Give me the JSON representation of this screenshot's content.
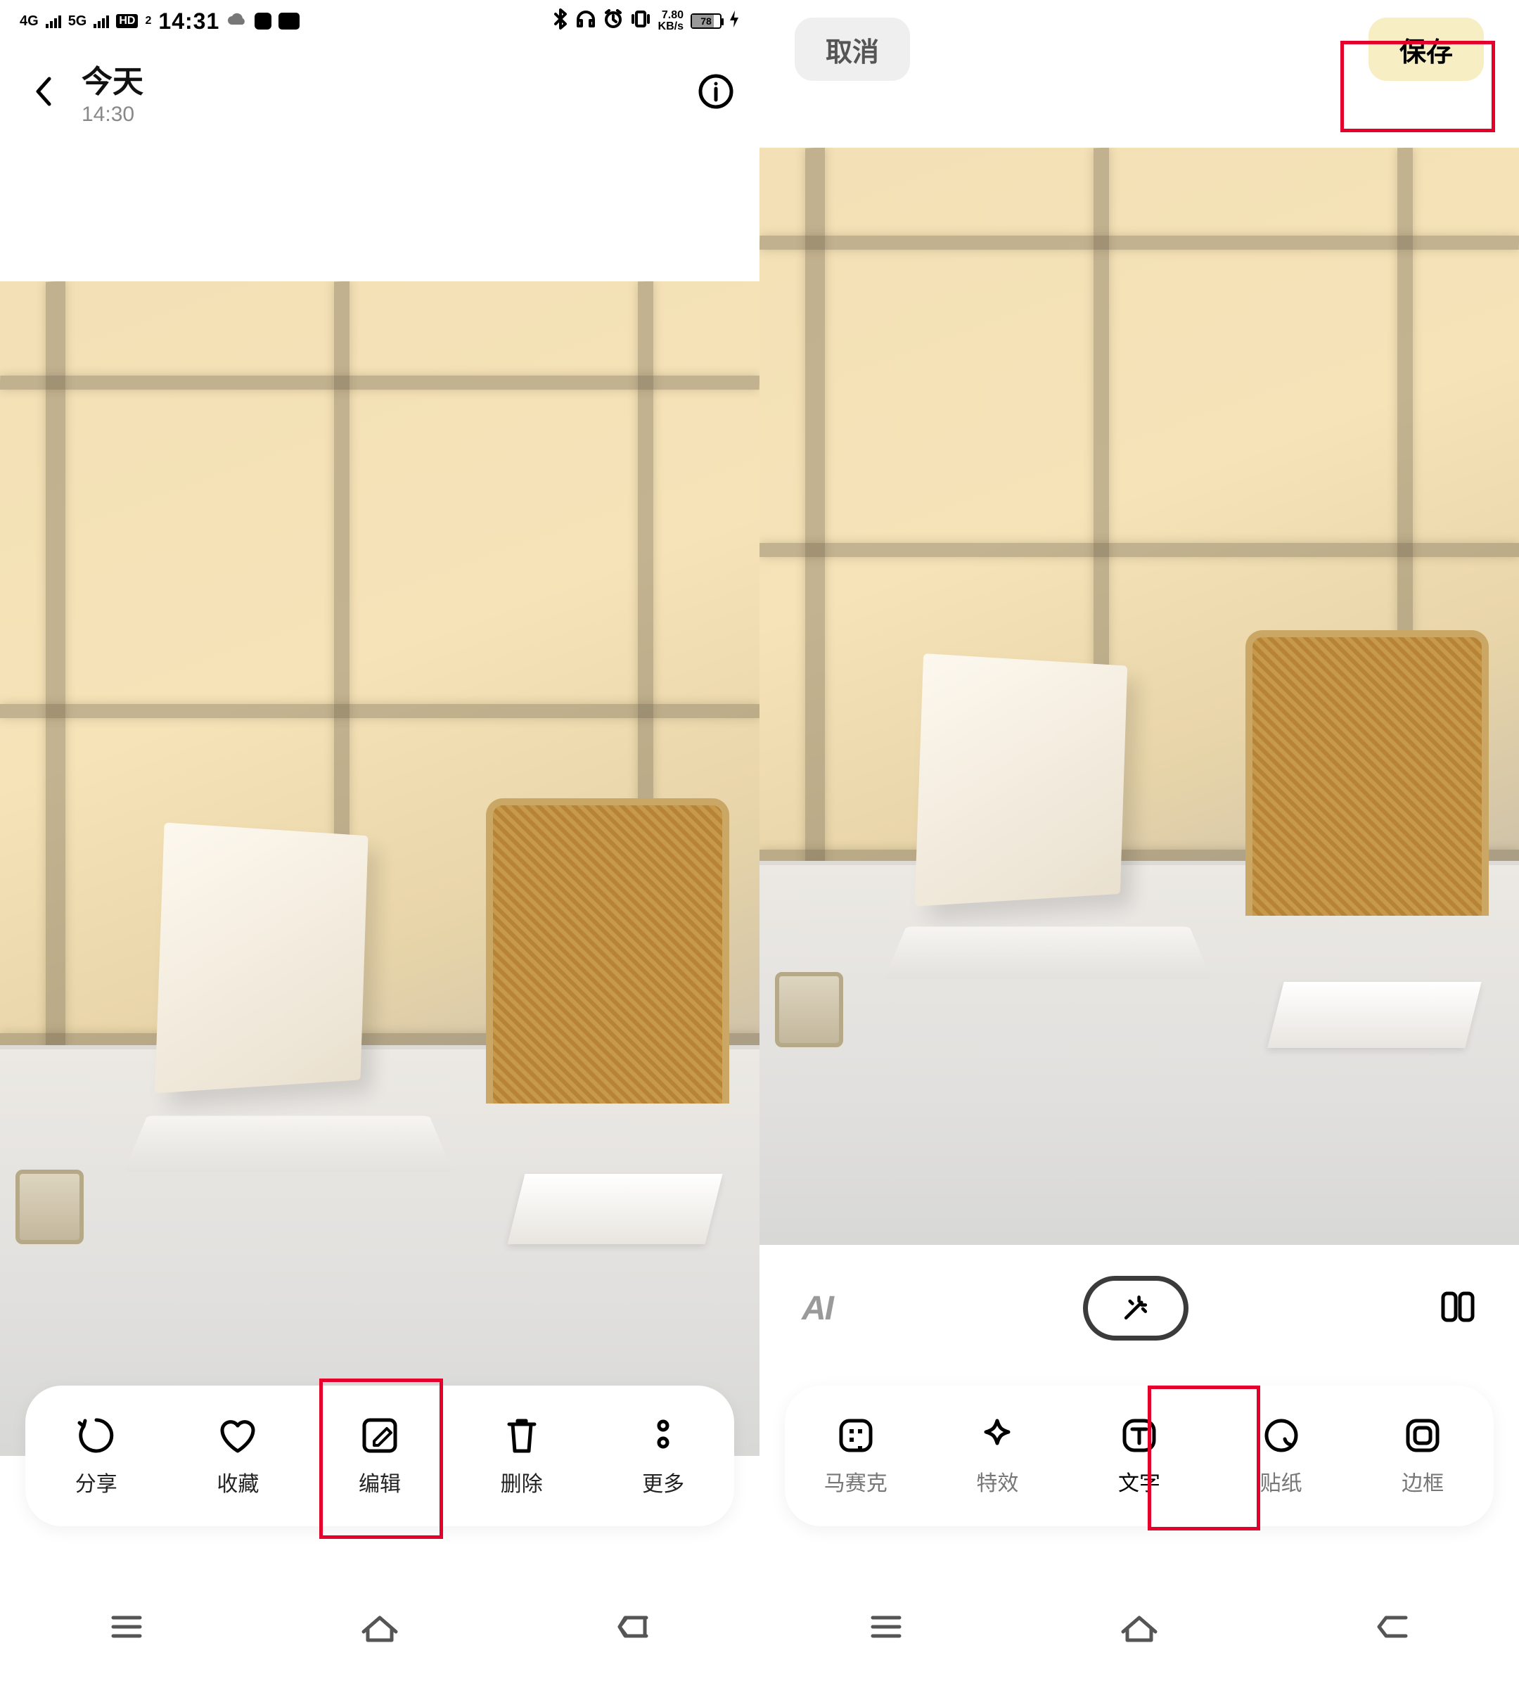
{
  "statusbar": {
    "net1": "4G",
    "net2": "5G",
    "hd": "HD",
    "hd2": "2",
    "time": "14:31",
    "speed_top": "7.80",
    "speed_bot": "KB/s",
    "battery_pct": "78"
  },
  "left": {
    "title": "今天",
    "subtitle": "14:30",
    "actions": {
      "share": "分享",
      "favorite": "收藏",
      "edit": "编辑",
      "delete": "删除",
      "more": "更多"
    }
  },
  "right": {
    "cancel": "取消",
    "save": "保存",
    "ai": "AI",
    "tools": {
      "mosaic": "马赛克",
      "effect": "特效",
      "text": "文字",
      "sticker": "贴纸",
      "frame": "边框"
    }
  }
}
